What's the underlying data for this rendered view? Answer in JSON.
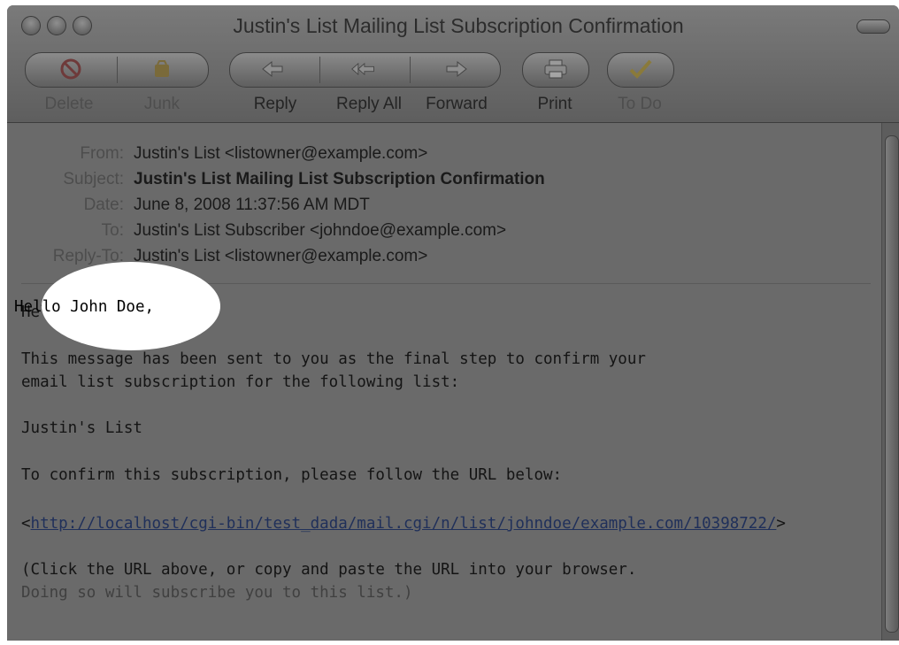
{
  "window": {
    "title": "Justin's List Mailing List Subscription Confirmation"
  },
  "toolbar": {
    "delete": {
      "label": "Delete",
      "icon": "prohibited-icon"
    },
    "junk": {
      "label": "Junk",
      "icon": "junk-bag-icon"
    },
    "reply": {
      "label": "Reply",
      "icon": "reply-arrow-icon"
    },
    "reply_all": {
      "label": "Reply All",
      "icon": "reply-all-arrow-icon"
    },
    "forward": {
      "label": "Forward",
      "icon": "forward-arrow-icon"
    },
    "print": {
      "label": "Print",
      "icon": "printer-icon"
    },
    "todo": {
      "label": "To Do",
      "icon": "checkmark-icon"
    }
  },
  "headers": {
    "from_label": "From:",
    "from": "Justin's List <listowner@example.com>",
    "subject_label": "Subject:",
    "subject": "Justin's List Mailing List Subscription Confirmation",
    "date_label": "Date:",
    "date": "June 8, 2008 11:37:56 AM MDT",
    "to_label": "To:",
    "to": "Justin's List Subscriber <johndoe@example.com>",
    "replyto_label": "Reply-To:",
    "replyto": "Justin's List <listowner@example.com>"
  },
  "body": {
    "greeting": "Hello John Doe,",
    "p1_line1": "This message has been sent to you as the final step to confirm your",
    "p1_line2": "email list subscription for the following list:",
    "list_name": "Justin's List",
    "instruction": "To confirm this subscription, please follow the URL below:",
    "url_open": "<",
    "url": "http://localhost/cgi-bin/test_dada/mail.cgi/n/list/johndoe/example.com/10398722/",
    "url_close": ">",
    "note_line1": "(Click the URL above, or copy and paste the URL into your browser.",
    "note_line2": "Doing so will subscribe you to this list.)"
  },
  "colors": {
    "window_overlay": "#6a6a6a",
    "link": "#20305a",
    "highlight": "#ffffff"
  }
}
